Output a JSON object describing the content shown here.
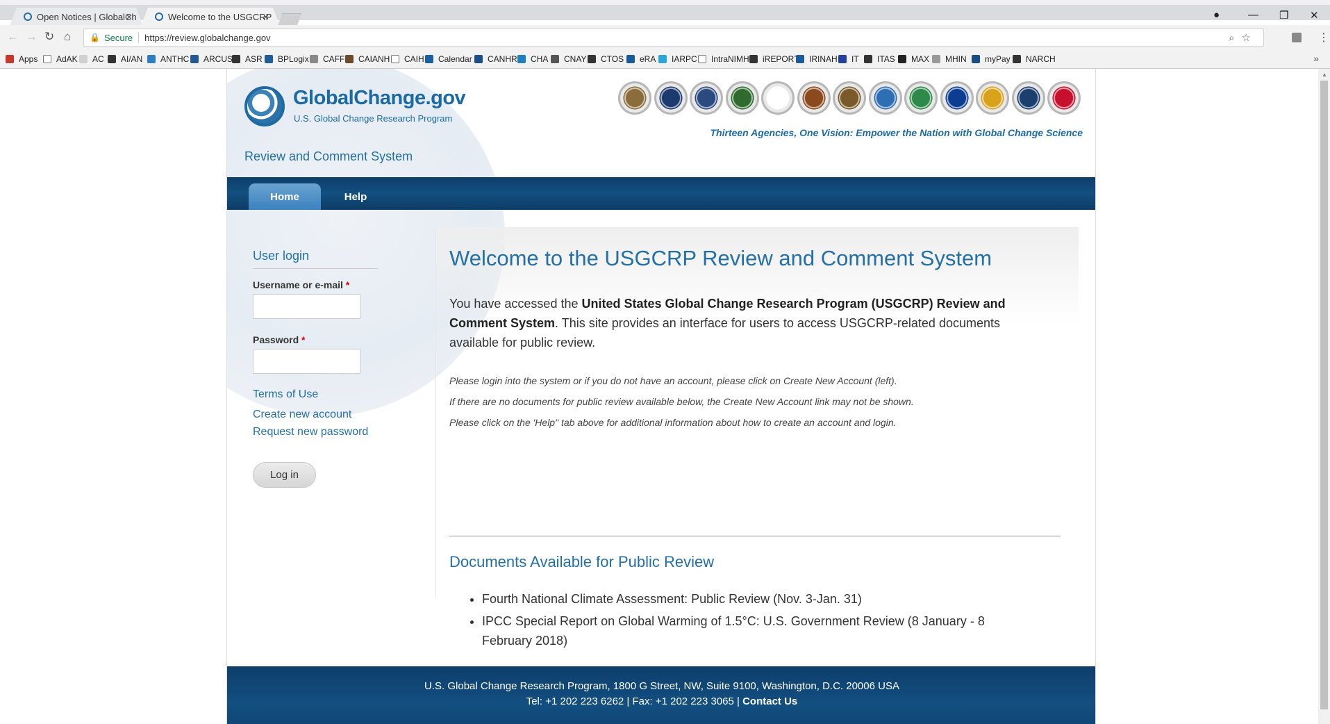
{
  "browser": {
    "tabs": [
      {
        "title": "Open Notices | GlobalCh",
        "close": "×"
      },
      {
        "title": "Welcome to the USGCRP",
        "close": "×"
      }
    ],
    "omnibox": {
      "secure_label": "Secure",
      "url": "https://review.globalchange.gov"
    },
    "bookmarks": [
      {
        "label": "Apps",
        "icon": "apps-grid-icon",
        "color": "#c8372d"
      },
      {
        "label": "AdAK",
        "icon": "page-icon",
        "color": "#ffffff"
      },
      {
        "label": "AC",
        "icon": "circle-icon",
        "color": "#d0d0d0"
      },
      {
        "label": "AI/AN",
        "icon": "arrow-icon",
        "color": "#333333"
      },
      {
        "label": "ANTHC",
        "icon": "flower-icon",
        "color": "#2d7fc1"
      },
      {
        "label": "ARCUS",
        "icon": "mountain-icon",
        "color": "#235a92"
      },
      {
        "label": "ASR",
        "icon": "arrow-icon",
        "color": "#333333"
      },
      {
        "label": "BPLogix",
        "icon": "x-icon",
        "color": "#1f5f99"
      },
      {
        "label": "CAFF",
        "icon": "flag-icon",
        "color": "#888888"
      },
      {
        "label": "CAIANH",
        "icon": "hands-icon",
        "color": "#6b4b2a"
      },
      {
        "label": "CAIH",
        "icon": "page-icon",
        "color": "#ffffff"
      },
      {
        "label": "Calendar",
        "icon": "calendar-icon",
        "color": "#1a5f9e"
      },
      {
        "label": "CANHR",
        "icon": "person-icon",
        "color": "#1b4f8a"
      },
      {
        "label": "CHA",
        "icon": "swirl-icon",
        "color": "#1f7fc0"
      },
      {
        "label": "CNAY",
        "icon": "circle-icon",
        "color": "#555555"
      },
      {
        "label": "CTOS",
        "icon": "arrow-icon",
        "color": "#333333"
      },
      {
        "label": "eRA",
        "icon": "era-icon",
        "color": "#1b5a9a"
      },
      {
        "label": "IARPC",
        "icon": "drop-icon",
        "color": "#2aa6d6"
      },
      {
        "label": "IntraNIMH",
        "icon": "page-icon",
        "color": "#ffffff"
      },
      {
        "label": "iREPORT",
        "icon": "arrow-icon",
        "color": "#333333"
      },
      {
        "label": "IRINAH",
        "icon": "leaf-icon",
        "color": "#1d5a9c"
      },
      {
        "label": "IT",
        "icon": "shield-icon",
        "color": "#2140a0"
      },
      {
        "label": "ITAS",
        "icon": "arrow-icon",
        "color": "#333333"
      },
      {
        "label": "MAX",
        "icon": "globe-icon",
        "color": "#222222"
      },
      {
        "label": "MHIN",
        "icon": "dots-icon",
        "color": "#999999"
      },
      {
        "label": "myPay",
        "icon": "card-icon",
        "color": "#1a4d86"
      },
      {
        "label": "NARCH",
        "icon": "arrow-icon",
        "color": "#333333"
      }
    ],
    "more": "»"
  },
  "site": {
    "logo_title": "GlobalChange.gov",
    "logo_subtitle": "U.S. Global Change Research Program",
    "system_name": "Review and Comment System",
    "tagline": "Thirteen Agencies, One Vision: Empower the Nation with Global Change Science",
    "agency_seals": [
      {
        "name": "usda-seal-icon",
        "color": "#8a6d3b"
      },
      {
        "name": "doc-seal-icon",
        "color": "#1d3a6e"
      },
      {
        "name": "dod-seal-icon",
        "color": "#2b4a7f"
      },
      {
        "name": "doe-seal-icon",
        "color": "#2f6b2f"
      },
      {
        "name": "hhs-seal-icon",
        "color": "#ffffff"
      },
      {
        "name": "doi-seal-icon",
        "color": "#8b4a1e"
      },
      {
        "name": "dos-seal-icon",
        "color": "#7a5a2a"
      },
      {
        "name": "dot-seal-icon",
        "color": "#2e6fb3"
      },
      {
        "name": "epa-seal-icon",
        "color": "#2d8a4a"
      },
      {
        "name": "nasa-seal-icon",
        "color": "#0b3d91"
      },
      {
        "name": "nsf-seal-icon",
        "color": "#d9a21b"
      },
      {
        "name": "smithsonian-seal-icon",
        "color": "#1c3f6e"
      },
      {
        "name": "usaid-seal-icon",
        "color": "#c8102e"
      }
    ],
    "nav": {
      "home": "Home",
      "help": "Help"
    }
  },
  "sidebar": {
    "login_title": "User login",
    "username_label": "Username or e-mail",
    "password_label": "Password",
    "required_mark": "*",
    "terms_link": "Terms of Use",
    "create_account_link": "Create new account",
    "request_password_link": "Request new password",
    "login_button": "Log in"
  },
  "main": {
    "title": "Welcome to the USGCRP Review and Comment System",
    "intro_prefix": "You have accessed the ",
    "intro_bold": "United States Global Change Research Program (USGCRP) Review and Comment System",
    "intro_suffix": ". This site provides an interface for users to access USGCRP-related documents available for public review.",
    "notes": [
      "Please login into the system or if you do not have an account, please click on Create New Account (left).",
      "If there are no documents for public review available below, the Create New Account link may not be shown.",
      "Please click on the 'Help\" tab above for additional information about how to create an account and login."
    ],
    "docs_title": "Documents Available for Public Review",
    "documents": [
      "Fourth National Climate Assessment: Public Review (Nov. 3-Jan. 31)",
      "IPCC Special Report on Global Warming of 1.5°C: U.S. Government Review (8 January - 8 February 2018)"
    ]
  },
  "footer": {
    "address": "U.S. Global Change Research Program, 1800 G Street, NW, Suite 9100, Washington, D.C. 20006 USA",
    "contact_prefix": "Tel: +1 202 223 6262 | Fax: +1 202 223 3065 | ",
    "contact_link": "Contact Us"
  }
}
